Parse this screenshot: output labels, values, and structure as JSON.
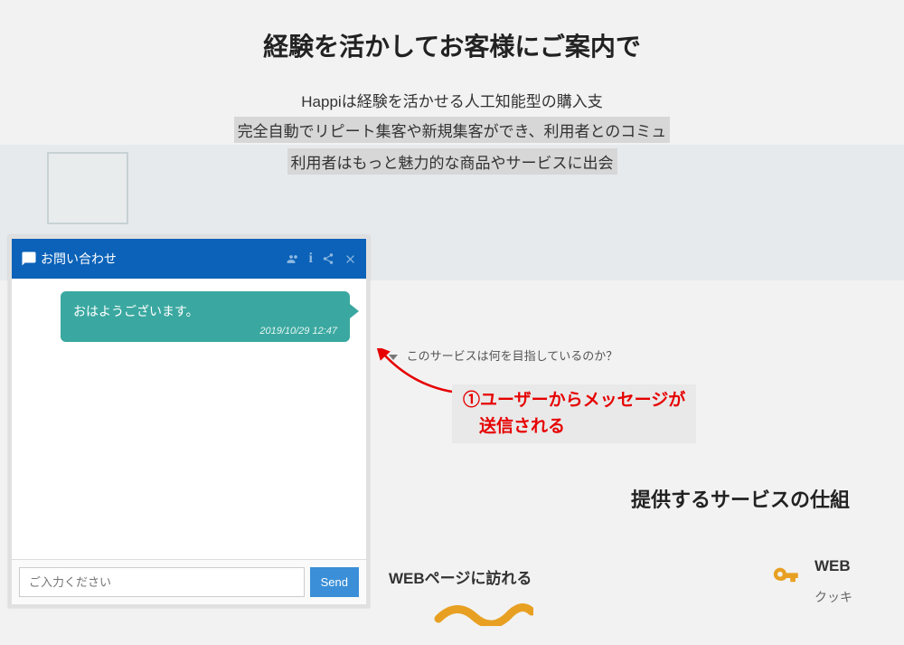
{
  "hero": {
    "title": "経験を活かしてお客様にご案内で",
    "sub1": "Happiは経験を活かせる人工知能型の購入支",
    "sub2": "完全自動でリピート集客や新規集客ができ、利用者とのコミュ",
    "sub3": "利用者はもっと魅力的な商品やサービスに出会"
  },
  "faq": {
    "q1": "このサービスは何を目指しているのか？"
  },
  "annotation": {
    "line1": "①ユーザーからメッセージが",
    "line2": "送信される"
  },
  "section_title": "提供するサービスの仕組",
  "services": {
    "s1": {
      "title": "WEBページに訪れる"
    },
    "s2": {
      "title": "WEB",
      "desc": "クッキ"
    }
  },
  "chat": {
    "title": "お問い合わせ",
    "message": "おはようございます。",
    "timestamp": "2019/10/29 12:47",
    "input_placeholder": "ご入力ください",
    "send_label": "Send"
  }
}
